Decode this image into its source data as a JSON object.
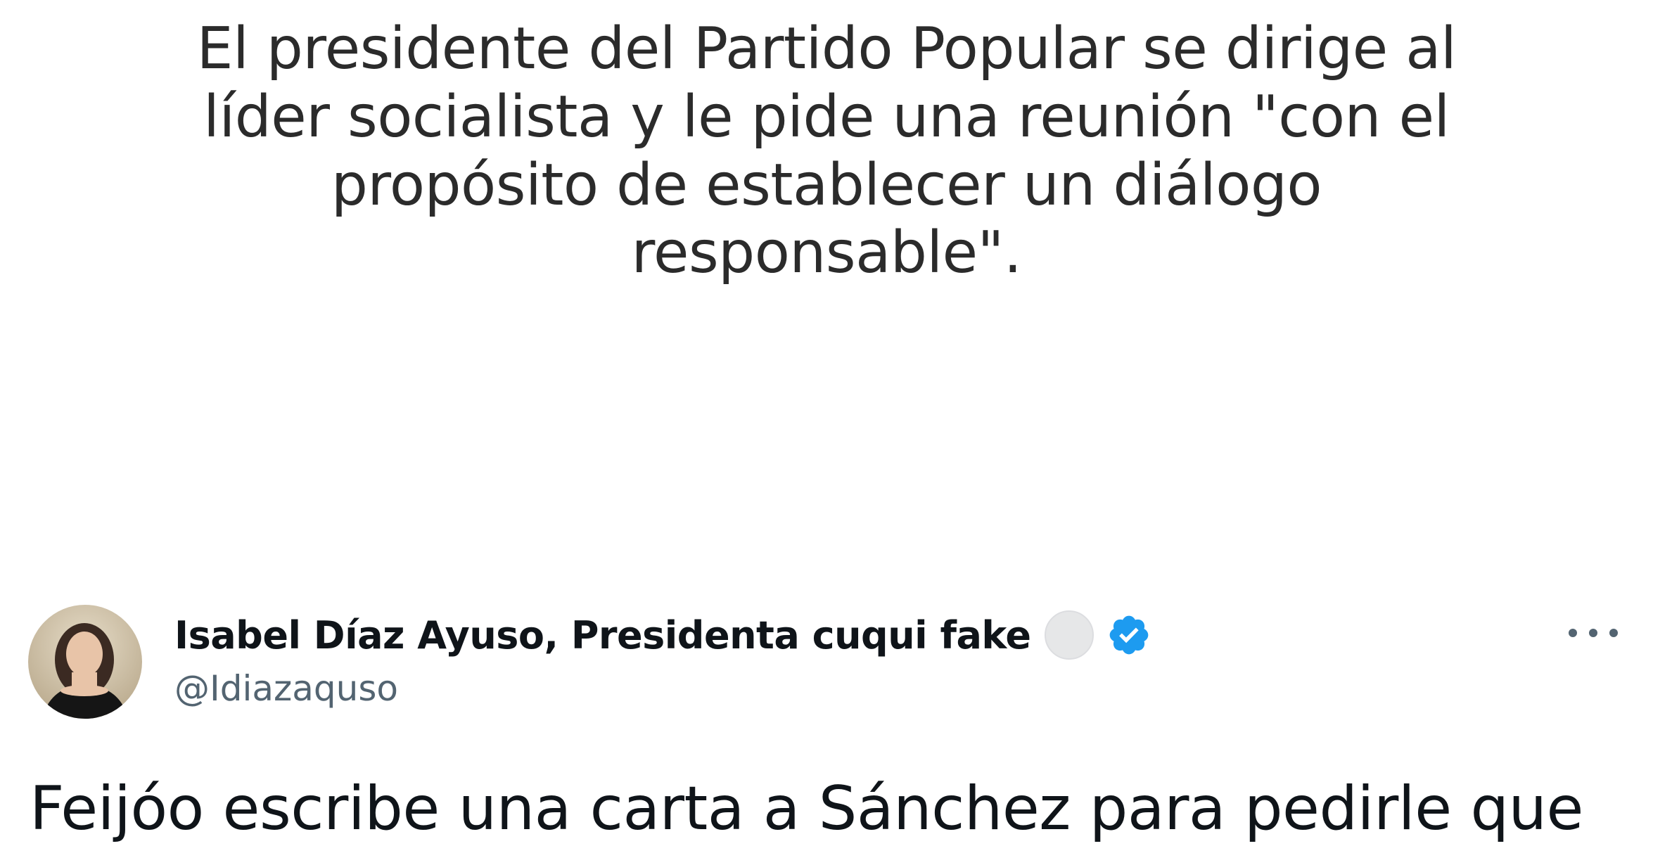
{
  "summary": {
    "lines": [
      "El presidente del Partido Popular se dirige al",
      "líder socialista y le pide una reunión \"con el",
      "propósito de establecer un diálogo",
      "responsable\"."
    ]
  },
  "tweet": {
    "display_name": "Isabel Díaz Ayuso, Presidenta cuqui fake",
    "handle": "@Idiazaquso",
    "text_line_1": "Feijóo escribe una carta a Sánchez para pedirle que",
    "text_line_2": "",
    "icons": {
      "more": "more-horizontal-icon",
      "verified": "verified-badge-icon",
      "affiliation": "grey-circle-badge"
    },
    "colors": {
      "verified": "#1d9bf0",
      "handle": "#536471",
      "name": "#0f1419"
    }
  }
}
